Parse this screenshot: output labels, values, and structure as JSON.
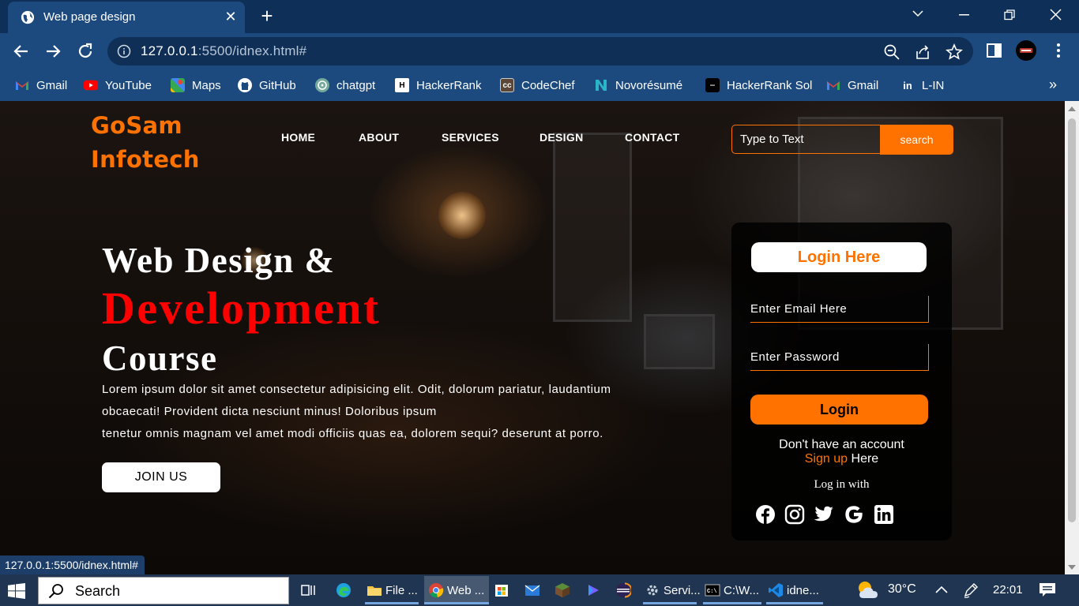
{
  "browser": {
    "tab_title": "Web page design",
    "tab_close": "✕",
    "new_tab": "+",
    "url_host": "127.0.0.1",
    "url_rest": ":5500/idnex.html#",
    "bookmarks": [
      {
        "label": "Gmail",
        "icon": "gmail-icon",
        "color": "#ea4335"
      },
      {
        "label": "YouTube",
        "icon": "youtube-icon",
        "color": "#ff0000"
      },
      {
        "label": "Maps",
        "icon": "maps-icon",
        "color": "#34a853"
      },
      {
        "label": "GitHub",
        "icon": "github-icon",
        "color": "#ffffff"
      },
      {
        "label": "chatgpt",
        "icon": "chatgpt-icon",
        "color": "#74aa9c"
      },
      {
        "label": "HackerRank",
        "icon": "hackerrank-icon",
        "color": "#ffffff"
      },
      {
        "label": "CodeChef",
        "icon": "codechef-icon",
        "color": "#5b4638"
      },
      {
        "label": "Novorésumé",
        "icon": "novoresume-icon",
        "color": "#2bb5c8"
      },
      {
        "label": "HackerRank Sol",
        "icon": "hackerrank-sol-icon",
        "color": "#000000"
      },
      {
        "label": "Gmail",
        "icon": "gmail-icon",
        "color": "#ea4335"
      },
      {
        "label": "L-IN",
        "icon": "linkedin-icon",
        "color": "#0a66c2"
      }
    ],
    "bookmarks_more": "»",
    "status_url": "127.0.0.1:5500/idnex.html#"
  },
  "page": {
    "logo_line1": "GoSam",
    "logo_line2": "Infotech",
    "nav": [
      "HOME",
      "ABOUT",
      "SERVICES",
      "DESIGN",
      "CONTACT"
    ],
    "search_placeholder": "Type to Text",
    "search_button": "search",
    "hero_line1": "Web Design &",
    "hero_line2": "Development",
    "hero_line3": "Course",
    "lorem_line1": "Lorem ipsum dolor sit amet consectetur adipisicing elit. Odit, dolorum pariatur, laudantium",
    "lorem_line2": "obcaecati! Provident dicta nesciunt minus! Doloribus ipsum",
    "lorem_line3": "tenetur omnis magnam vel amet modi officiis quas ea, dolorem sequi? deserunt at porro.",
    "join_button": "JOIN US",
    "form": {
      "heading": "Login Here",
      "email_placeholder": "Enter Email Here",
      "password_placeholder": "Enter Password",
      "login_button": "Login",
      "no_account": "Don't have an account",
      "signup_link": "Sign up",
      "signup_rest": " Here",
      "login_with": "Log in with",
      "socials": [
        "facebook-icon",
        "instagram-icon",
        "twitter-icon",
        "google-icon",
        "linkedin-icon"
      ]
    },
    "accent_color": "#ff7200",
    "hero_accent": "#ff0000"
  },
  "taskbar": {
    "search_label": "Search",
    "apps": [
      {
        "label": "",
        "icon": "task-view-icon"
      },
      {
        "label": "",
        "icon": "edge-icon"
      },
      {
        "label": "File ...",
        "icon": "file-explorer-icon"
      },
      {
        "label": "Web ...",
        "icon": "chrome-icon"
      },
      {
        "label": "",
        "icon": "store-icon"
      },
      {
        "label": "",
        "icon": "mail-icon"
      },
      {
        "label": "",
        "icon": "minecraft-icon"
      },
      {
        "label": "",
        "icon": "power-automate-icon"
      },
      {
        "label": "",
        "icon": "eclipse-icon"
      },
      {
        "label": "Servi...",
        "icon": "services-icon"
      },
      {
        "label": "C:\\W...",
        "icon": "cmd-icon"
      },
      {
        "label": "idne...",
        "icon": "vscode-icon"
      }
    ],
    "temperature": "30°C",
    "time": "22:01"
  }
}
